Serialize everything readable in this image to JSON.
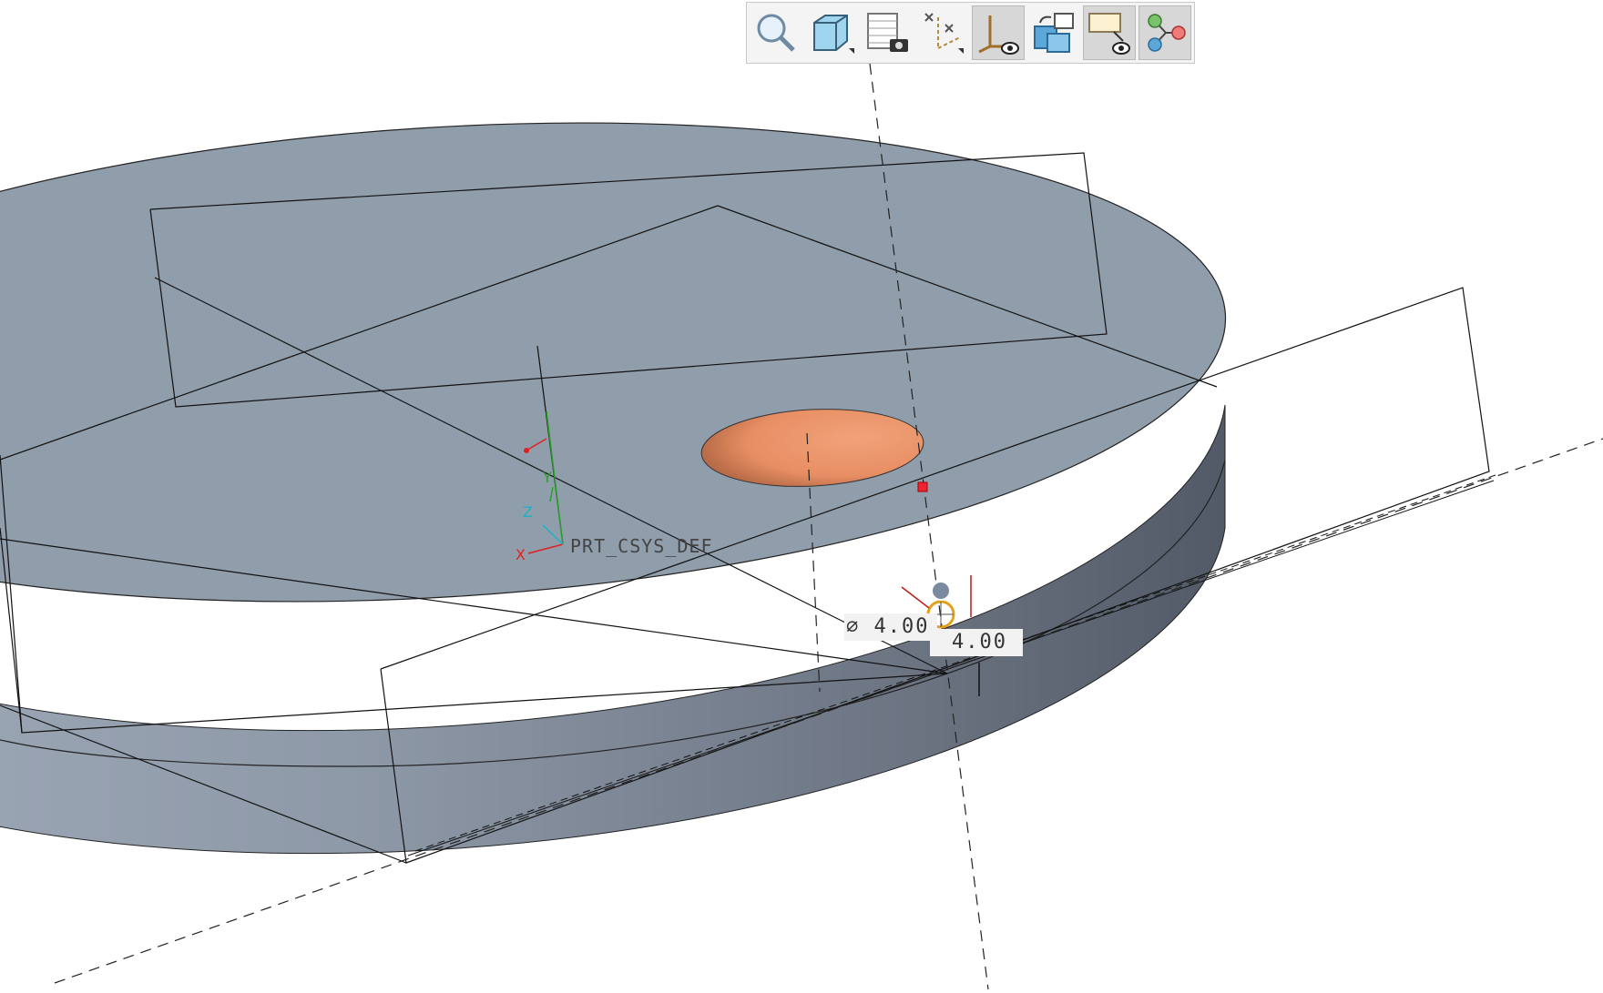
{
  "toolbar": {
    "buttons": [
      {
        "name": "refit",
        "icon": "zoom-magnifier-icon",
        "active": false
      },
      {
        "name": "saved-orientations",
        "icon": "cube-view-icon",
        "active": false
      },
      {
        "name": "saved-views",
        "icon": "view-manager-camera-icon",
        "active": false
      },
      {
        "name": "datum-display-filters",
        "icon": "datum-axes-display-icon",
        "active": false
      },
      {
        "name": "csys-display",
        "icon": "csys-display-icon",
        "active": true
      },
      {
        "name": "spin-center",
        "icon": "repaint-windows-icon",
        "active": false
      },
      {
        "name": "annotation-display",
        "icon": "annotation-display-icon",
        "active": true
      },
      {
        "name": "model-tree-display",
        "icon": "feature-flow-icon",
        "active": true
      }
    ]
  },
  "model": {
    "csys_label": "PRT_CSYS_DEF",
    "csys_axes": [
      "X",
      "Y",
      "Z"
    ],
    "dimensions": {
      "diameter": "∅ 4.00",
      "offset": "4.00"
    }
  },
  "colors": {
    "disc_top": "#909dab",
    "disc_side_dark": "#5a6270",
    "hole": "#e8926a",
    "active_button": "#d7d7d7"
  }
}
